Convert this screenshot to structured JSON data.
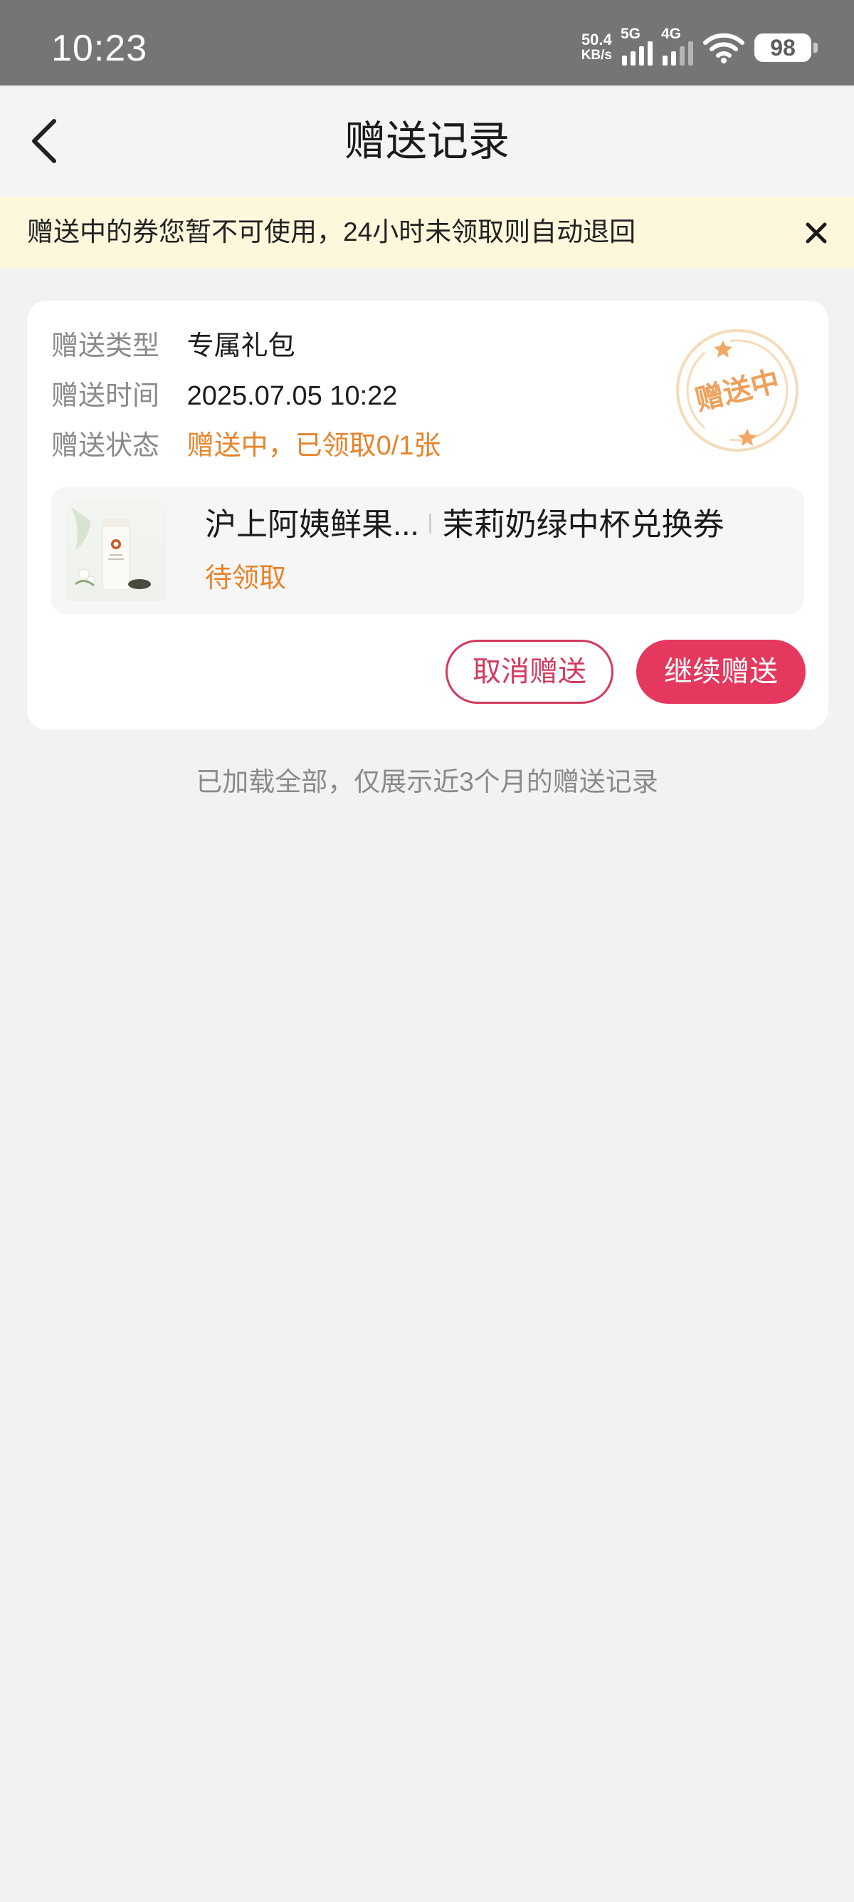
{
  "status_bar": {
    "time": "10:23",
    "net_speed_value": "50.4",
    "net_speed_unit": "KB/s",
    "signal1_label": "5G",
    "signal2_label": "4G",
    "battery": "98"
  },
  "nav": {
    "title": "赠送记录",
    "back_icon": "chevron-left-icon"
  },
  "notice": {
    "text": "赠送中的券您暂不可使用，24小时未领取则自动退回",
    "close_icon": "close-icon"
  },
  "record": {
    "type_label": "赠送类型",
    "type_value": "专属礼包",
    "time_label": "赠送时间",
    "time_value": "2025.07.05 10:22",
    "status_label": "赠送状态",
    "status_value": "赠送中，已领取0/1张",
    "stamp_text": "赠送中",
    "product": {
      "brand": "沪上阿姨鲜果...",
      "name": "茉莉奶绿中杯兑换券",
      "status": "待领取"
    },
    "cancel_label": "取消赠送",
    "continue_label": "继续赠送"
  },
  "footer": {
    "text": "已加载全部，仅展示近3个月的赠送记录"
  },
  "colors": {
    "accent": "#e5385e",
    "orange": "#e8832a",
    "notice_bg": "#fdf7dc"
  }
}
